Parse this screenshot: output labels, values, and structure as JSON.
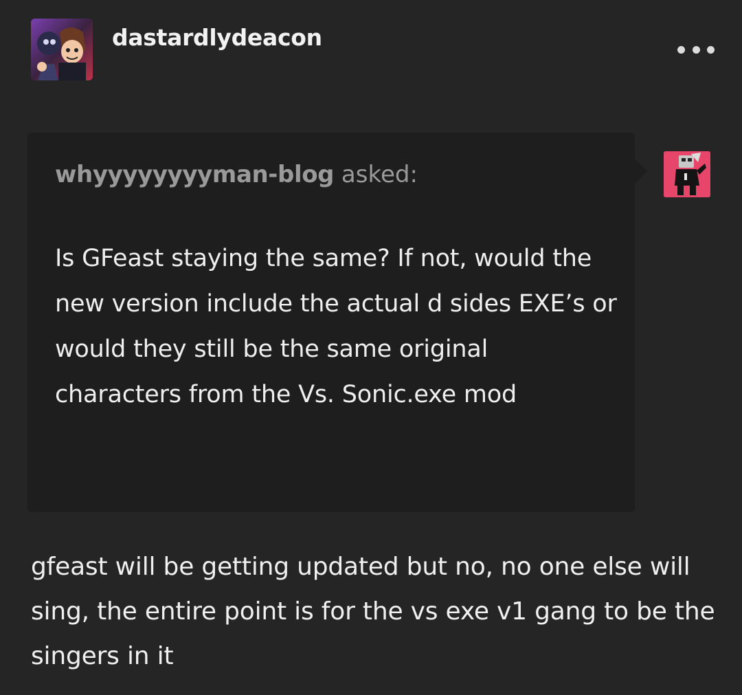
{
  "post": {
    "author": "dastardlydeacon",
    "author_avatar_icon": "blog-avatar-icon",
    "more_icon": "more-options-icon"
  },
  "ask": {
    "asker": "whyyyyyyyyman-blog",
    "asked_label": "asked:",
    "question": "Is GFeast staying the same? If not, would the new version include the actual d sides EXE’s or would they still be the same original characters from the Vs. Sonic.exe mod",
    "asker_avatar_icon": "asker-avatar-icon"
  },
  "answer": {
    "text": "gfeast will be getting updated but no, no one else will sing, the entire point is for the vs exe v1 gang to be the singers in it"
  },
  "colors": {
    "background": "#252525",
    "ask_background": "#1e1e1e",
    "asker_avatar_bg": "#e8456a"
  }
}
